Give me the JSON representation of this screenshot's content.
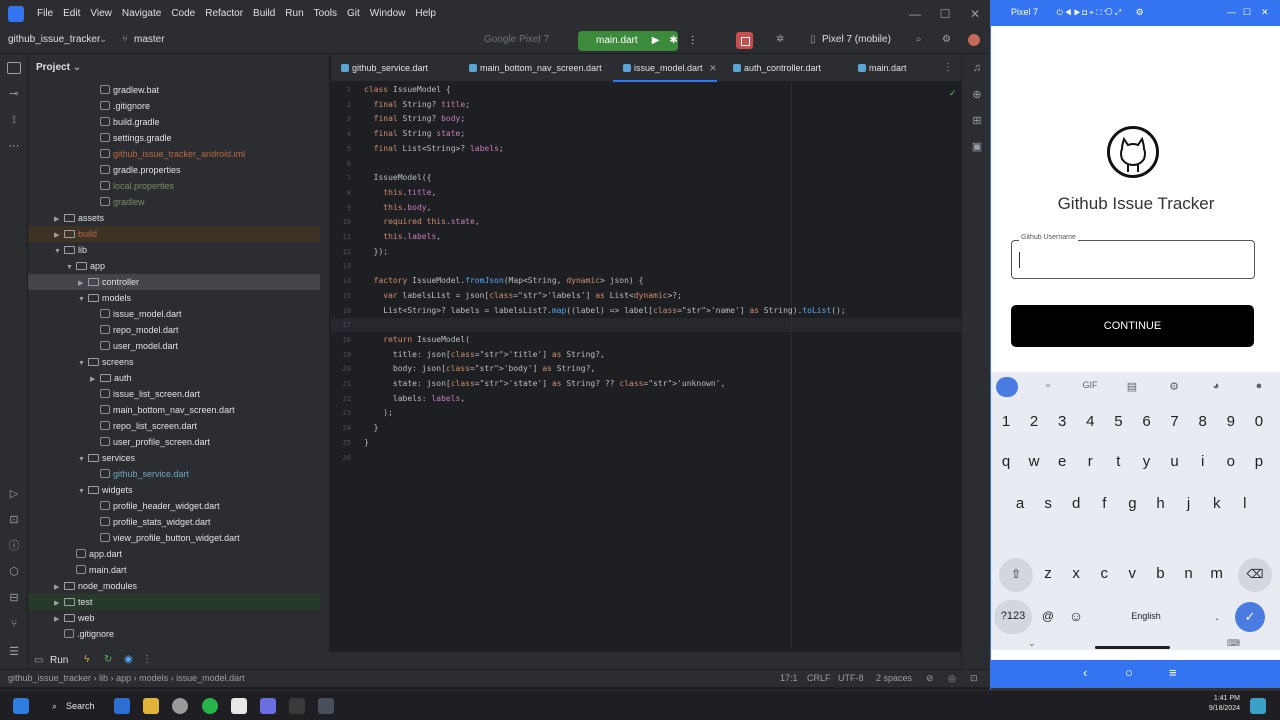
{
  "menu": {
    "items": [
      "File",
      "Edit",
      "View",
      "Navigate",
      "Code",
      "Refactor",
      "Build",
      "Run",
      "Tools",
      "Git",
      "Window",
      "Help"
    ]
  },
  "toolbar": {
    "project": "github_issue_tracker",
    "branch": "master",
    "device_selector": "Google Pixel 7",
    "run_config": "main.dart",
    "emulator_device": "Pixel 7 (mobile)"
  },
  "project_panel": {
    "title": "Project",
    "tree": [
      {
        "label": "gradlew.bat",
        "kind": "file"
      },
      {
        "label": ".gitignore",
        "kind": "file"
      },
      {
        "label": "build.gradle",
        "kind": "file"
      },
      {
        "label": "settings.gradle",
        "kind": "file"
      },
      {
        "label": "github_issue_tracker_android.iml",
        "kind": "file"
      },
      {
        "label": "gradle.properties",
        "kind": "file"
      },
      {
        "label": "local.properties",
        "kind": "file"
      },
      {
        "label": "gradlew",
        "kind": "file"
      },
      {
        "label": "assets",
        "kind": "folder"
      },
      {
        "label": "build",
        "kind": "folder"
      },
      {
        "label": "lib",
        "kind": "folder"
      },
      {
        "label": "app",
        "kind": "folder"
      },
      {
        "label": "controller",
        "kind": "folder"
      },
      {
        "label": "models",
        "kind": "folder"
      },
      {
        "label": "issue_model.dart",
        "kind": "file"
      },
      {
        "label": "repo_model.dart",
        "kind": "file"
      },
      {
        "label": "user_model.dart",
        "kind": "file"
      },
      {
        "label": "screens",
        "kind": "folder"
      },
      {
        "label": "auth",
        "kind": "folder"
      },
      {
        "label": "issue_list_screen.dart",
        "kind": "file"
      },
      {
        "label": "main_bottom_nav_screen.dart",
        "kind": "file"
      },
      {
        "label": "repo_list_screen.dart",
        "kind": "file"
      },
      {
        "label": "user_profile_screen.dart",
        "kind": "file"
      },
      {
        "label": "services",
        "kind": "folder"
      },
      {
        "label": "github_service.dart",
        "kind": "file"
      },
      {
        "label": "widgets",
        "kind": "folder"
      },
      {
        "label": "profile_header_widget.dart",
        "kind": "file"
      },
      {
        "label": "profile_stats_widget.dart",
        "kind": "file"
      },
      {
        "label": "view_profile_button_widget.dart",
        "kind": "file"
      },
      {
        "label": "app.dart",
        "kind": "file"
      },
      {
        "label": "main.dart",
        "kind": "file"
      },
      {
        "label": "node_modules",
        "kind": "folder"
      },
      {
        "label": "test",
        "kind": "folder"
      },
      {
        "label": "web",
        "kind": "folder"
      },
      {
        "label": ".gitignore",
        "kind": "file"
      }
    ]
  },
  "tabs": [
    "github_service.dart",
    "main_bottom_nav_screen.dart",
    "issue_model.dart",
    "auth_controller.dart",
    "main.dart"
  ],
  "editor": {
    "line_numbers": [
      "1",
      "2",
      "3",
      "4",
      "5",
      "6",
      "7",
      "8",
      "9",
      "10",
      "11",
      "12",
      "13",
      "14",
      "15",
      "16",
      "17",
      "18",
      "19",
      "20",
      "21",
      "22",
      "23",
      "24",
      "25",
      "26"
    ],
    "lines": [
      "class IssueModel {",
      "  final String? title;",
      "  final String? body;",
      "  final String state;",
      "  final List<String>? labels;",
      "",
      "  IssueModel({",
      "    this.title,",
      "    this.body,",
      "    required this.state,",
      "    this.labels,",
      "  });",
      "",
      "  factory IssueModel.fromJson(Map<String, dynamic> json) {",
      "    var labelsList = json['labels'] as List<dynamic>?;",
      "    List<String>? labels = labelsList?.map((label) => label['name'] as String).toList();",
      "",
      "    return IssueModel(",
      "      title: json['title'] as String?,",
      "      body: json['body'] as String?,",
      "      state: json['state'] as String? ?? 'unknown',",
      "      labels: labels,",
      "    );",
      "  }",
      "}",
      ""
    ]
  },
  "bottom_tool": {
    "run_label": "Run"
  },
  "statusbar": {
    "breadcrumb": [
      "github_issue_tracker",
      "lib",
      "app",
      "models",
      "issue_model.dart"
    ],
    "position": "17:1",
    "line_sep": "CRLF",
    "encoding": "UTF-8",
    "indent": "2 spaces"
  },
  "emulator": {
    "title": "Pixel 7",
    "app_name": "Github Issue Tracker",
    "field_label": "Github Username",
    "continue_label": "CONTINUE",
    "kbd_tools": [
      "GIF"
    ],
    "row_numbers": [
      "1",
      "2",
      "3",
      "4",
      "5",
      "6",
      "7",
      "8",
      "9",
      "0"
    ],
    "row1": [
      "q",
      "w",
      "e",
      "r",
      "t",
      "y",
      "u",
      "i",
      "o",
      "p"
    ],
    "row2": [
      "a",
      "s",
      "d",
      "f",
      "g",
      "h",
      "j",
      "k",
      "l"
    ],
    "row3": [
      "z",
      "x",
      "c",
      "v",
      "b",
      "n",
      "m"
    ],
    "sym_key": "?123",
    "at_key": "@",
    "space_label": "English",
    "period_key": "."
  },
  "taskbar": {
    "search_label": "Search",
    "time": "1:41 PM",
    "date": "9/18/2024"
  }
}
